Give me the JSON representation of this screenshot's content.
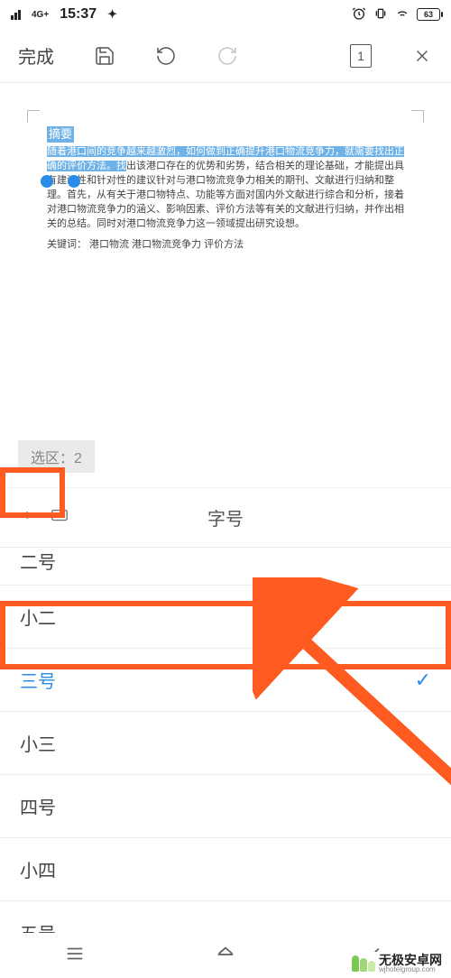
{
  "status": {
    "network": "4G+",
    "time": "15:37",
    "battery": "63"
  },
  "toolbar": {
    "done": "完成",
    "page": "1"
  },
  "document": {
    "title": "摘要",
    "body_pre": "随着港",
    "body_hl": "口间的竞争越来越激烈，如何做到正确提升港口物流竞争力，就需要找出正确的评价方法。找",
    "body_post": "出该港口存在的优势和劣势，结合相关的理论基础，才能提出具有建设性和针对性的建议针对与港口物流竞争力相关的期刊、文献进行归纳和整理。首先，从有关于港口物特点、功能等方面对国内外文献进行综合和分析，接着对港口物流竞争力的涵义、影响因素、评价方法等有关的文献进行归纳，并作出相关的总结。同时对港口物流竞争力这一领域提出研究设想。",
    "keywords": "关键词：  港口物流   港口物流竞争力    评价方法"
  },
  "selection": {
    "label": "选区：2"
  },
  "panel": {
    "title": "字号",
    "partial_item": "二号",
    "items": [
      {
        "label": "小二",
        "selected": false
      },
      {
        "label": "三号",
        "selected": true
      },
      {
        "label": "小三",
        "selected": false
      },
      {
        "label": "四号",
        "selected": false
      },
      {
        "label": "小四",
        "selected": false
      },
      {
        "label": "五号",
        "selected": false
      }
    ]
  },
  "watermark": {
    "cn": "无极安卓网",
    "en": "wjhotelgroup.com"
  }
}
